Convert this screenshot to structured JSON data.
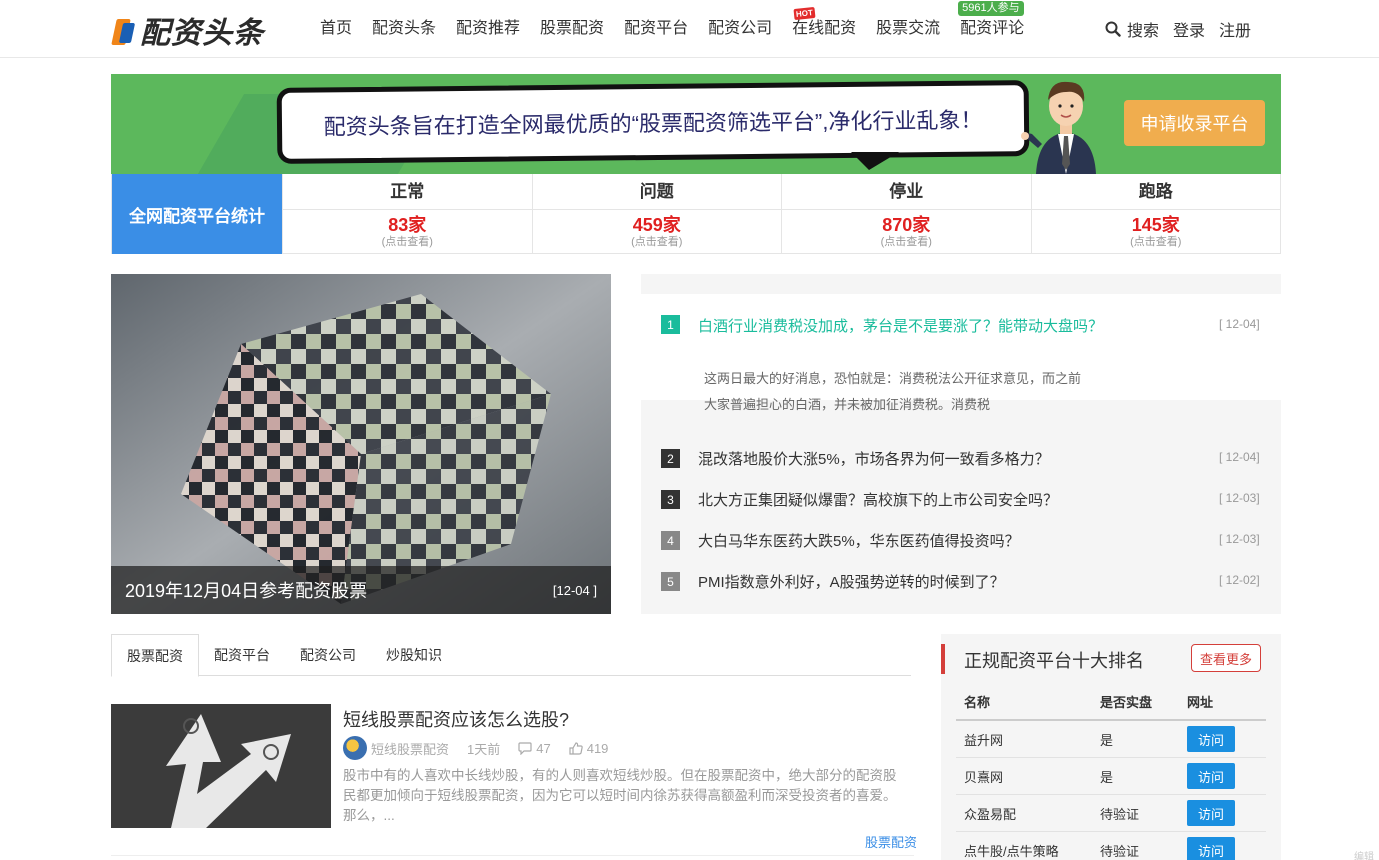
{
  "header": {
    "logo_text": "配资头条",
    "nav": [
      "首页",
      "配资头条",
      "配资推荐",
      "股票配资",
      "配资平台",
      "配资公司",
      "在线配资",
      "股票交流",
      "配资评论"
    ],
    "hot_badge": "HOT",
    "participants_badge": "5961人参与",
    "search_label": "搜索",
    "login_label": "登录",
    "register_label": "注册"
  },
  "banner": {
    "slogan": "配资头条旨在打造全网最优质的“股票配资筛选平台”,净化行业乱象！",
    "apply_button": "申请收录平台",
    "colors": {
      "background": "#5cb85c",
      "button": "#f0ad4e"
    }
  },
  "stats": {
    "heading": "全网配资平台统计",
    "columns": [
      {
        "title": "正常",
        "value": "83家",
        "hint": "(点击查看)"
      },
      {
        "title": "问题",
        "value": "459家",
        "hint": "(点击查看)"
      },
      {
        "title": "停业",
        "value": "870家",
        "hint": "(点击查看)"
      },
      {
        "title": "跑路",
        "value": "145家",
        "hint": "(点击查看)"
      }
    ]
  },
  "hero": {
    "caption": "2019年12月04日参考配资股票",
    "date": "[12-04 ]"
  },
  "news": [
    {
      "num": "1",
      "title": "白酒行业消费税没加成，茅台是不是要涨了？能带动大盘吗？",
      "date": "[ 12-04]",
      "desc_line1": "这两日最大的好消息，恐怕就是：消费税法公开征求意见，而之前",
      "desc_line2": "大家普遍担心的白酒，并未被加征消费税。消费税"
    },
    {
      "num": "2",
      "title": "混改落地股价大涨5%，市场各界为何一致看多格力？",
      "date": "[ 12-04]"
    },
    {
      "num": "3",
      "title": "北大方正集团疑似爆雷？高校旗下的上市公司安全吗？",
      "date": "[ 12-03]"
    },
    {
      "num": "4",
      "title": "大白马华东医药大跌5%，华东医药值得投资吗？",
      "date": "[ 12-03]"
    },
    {
      "num": "5",
      "title": "PMI指数意外利好，A股强势逆转的时候到了？",
      "date": "[ 12-02]"
    }
  ],
  "tabs": [
    "股票配资",
    "配资平台",
    "配资公司",
    "炒股知识"
  ],
  "article": {
    "title": "短线股票配资应该怎么选股?",
    "author": "短线股票配资",
    "time": "1天前",
    "comments": "47",
    "likes": "419",
    "desc": "股市中有的人喜欢中长线炒股，有的人则喜欢短线炒股。但在股票配资中，绝大部分的配资股民都更加倾向于短线股票配资，因为它可以短时间内徐苏获得高额盈利而深受投资者的喜爱。那么，...",
    "tag": "股票配资"
  },
  "ranking": {
    "title": "正规配资平台十大排名",
    "more": "查看更多",
    "headers": [
      "名称",
      "是否实盘",
      "网址"
    ],
    "rows": [
      {
        "name": "益升网",
        "real": "是",
        "visit": "访问"
      },
      {
        "name": "贝熹网",
        "real": "是",
        "visit": "访问"
      },
      {
        "name": "众盈易配",
        "real": "待验证",
        "visit": "访问"
      },
      {
        "name": "点牛股/点牛策略",
        "real": "待验证",
        "visit": "访问"
      }
    ]
  },
  "corner": "编辑"
}
